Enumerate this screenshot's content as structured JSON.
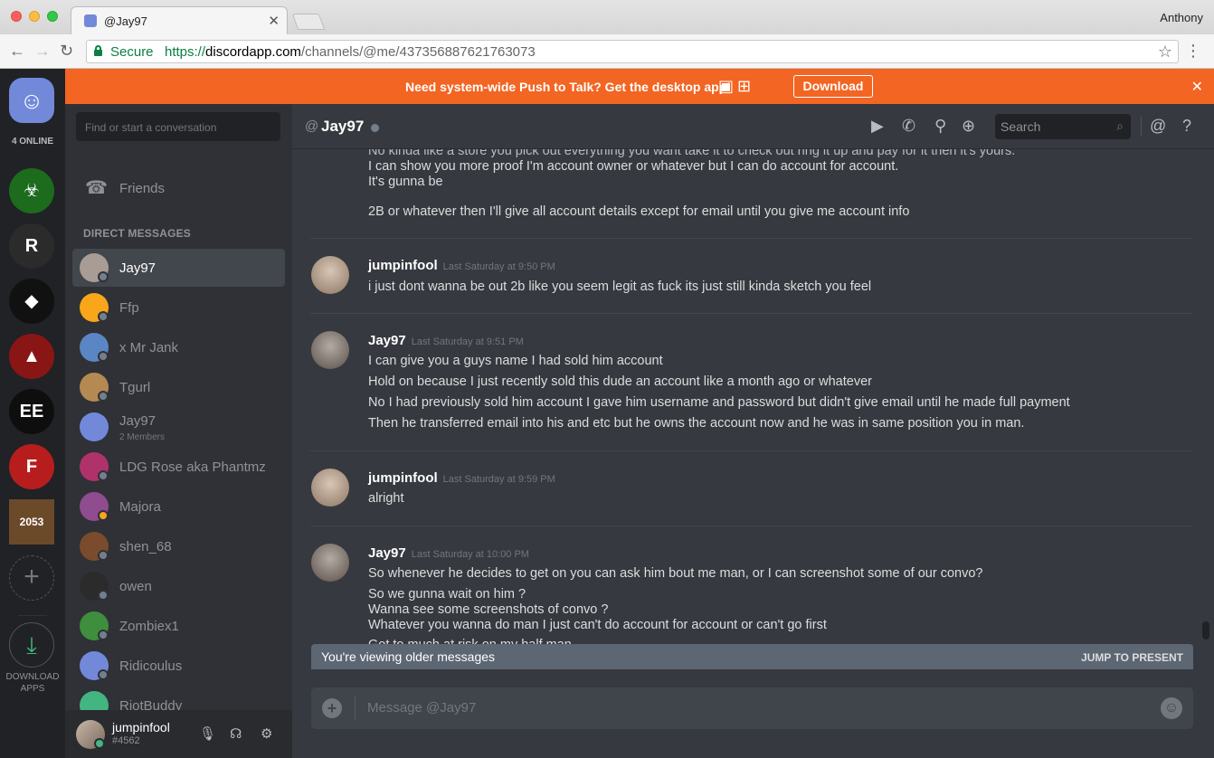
{
  "browser": {
    "tab_title": "@Jay97",
    "tab_close": "✕",
    "profile": "Anthony",
    "secure_label": "Secure",
    "url_scheme": "https://",
    "url_domain": "discordapp.com",
    "url_path": "/channels/@me/437356887621763073"
  },
  "notice": {
    "text": "Need system-wide Push to Talk? Get the desktop app!",
    "download_label": "Download",
    "close": "✕"
  },
  "guilds": {
    "online_count": "4 ONLINE",
    "servers": [
      {
        "name": "biohazard",
        "letter": "☣",
        "color": "#1d6b1d"
      },
      {
        "name": "runescape",
        "letter": "R",
        "color": "#2b2b2b"
      },
      {
        "name": "wolf",
        "letter": "◆",
        "color": "#111111"
      },
      {
        "name": "red-cloak",
        "letter": "▲",
        "color": "#8a1515"
      },
      {
        "name": "ee",
        "letter": "EE",
        "color": "#0e0e0e"
      },
      {
        "name": "f",
        "letter": "F",
        "color": "#b81d1d"
      },
      {
        "name": "2053",
        "letter": "2053",
        "color": "#6b4a2a"
      }
    ],
    "download_label_1": "DOWNLOAD",
    "download_label_2": "APPS"
  },
  "sidebar": {
    "search_placeholder": "Find or start a conversation",
    "friends_label": "Friends",
    "dm_header": "DIRECT MESSAGES",
    "dms": [
      {
        "name": "Jay97",
        "sub": "",
        "color": "#a89c94",
        "status": "#747f8d",
        "active": true
      },
      {
        "name": "Ffp",
        "sub": "",
        "color": "#faa61a",
        "status": "#747f8d"
      },
      {
        "name": "x Mr Jank",
        "sub": "",
        "color": "#5b86c4",
        "status": "#747f8d"
      },
      {
        "name": "Tgurl",
        "sub": "",
        "color": "#b48a52",
        "status": "#747f8d"
      },
      {
        "name": "Jay97",
        "sub": "2 Members",
        "color": "#7289da",
        "status": ""
      },
      {
        "name": "LDG Rose aka Phantmz",
        "sub": "",
        "color": "#b0326a",
        "status": "#747f8d"
      },
      {
        "name": "Majora",
        "sub": "",
        "color": "#8f4c8f",
        "status": "#faa61a"
      },
      {
        "name": "shen_68",
        "sub": "",
        "color": "#7a4b2c",
        "status": "#747f8d"
      },
      {
        "name": "owen",
        "sub": "",
        "color": "#2b2b2b",
        "status": "#747f8d"
      },
      {
        "name": "Zombiex1",
        "sub": "",
        "color": "#3e8e3e",
        "status": "#747f8d"
      },
      {
        "name": "Ridicoulus",
        "sub": "",
        "color": "#7289da",
        "status": "#747f8d"
      },
      {
        "name": "RiotBuddy",
        "sub": "",
        "color": "#43b581",
        "status": ""
      }
    ]
  },
  "user": {
    "name": "jumpinfool",
    "tag": "#4562"
  },
  "chat": {
    "at": "@",
    "title": "Jay97",
    "search_placeholder": "Search",
    "messages_top_partial": "No kinda like a store you pick out everything you want take it to check out ring it up and pay for it then it's yours.",
    "messages": [
      {
        "author": "",
        "time": "",
        "lines": [
          "I can show you more proof I'm account owner or whatever but I can do account for account.",
          "It's gunna be",
          "2B or whatever then I'll give all account details except for email until you give me account info"
        ]
      },
      {
        "author": "jumpinfool",
        "time": "Last Saturday at 9:50 PM",
        "lines": [
          "i just dont wanna be out 2b like you seem legit as fuck its just still kinda sketch you feel"
        ]
      },
      {
        "author": "Jay97",
        "time": "Last Saturday at 9:51 PM",
        "lines": [
          "I can give you a guys name I had sold him account",
          "Hold on because I just recently sold this dude an account like a month ago or whatever",
          "No I had previously sold him account I gave him username and password but didn't give email until he made full payment",
          "Then he transferred email into his and etc but he owns the account now and he was in same position you in man."
        ]
      },
      {
        "author": "jumpinfool",
        "time": "Last Saturday at 9:59 PM",
        "lines": [
          "alright"
        ]
      },
      {
        "author": "Jay97",
        "time": "Last Saturday at 10:00 PM",
        "lines": [
          "So whenever he decides to get on you can ask him bout me man, or I can screenshot some of our convo?",
          "So we gunna wait on him ?",
          "Wanna see some screenshots of convo ?",
          "Whatever you wanna do man I just can't do account for account or can't go first",
          "Got to much at risk on my half man."
        ]
      }
    ],
    "older_text": "You're viewing older messages",
    "jump_label": "JUMP TO PRESENT",
    "composer_placeholder": "Message @Jay97"
  }
}
